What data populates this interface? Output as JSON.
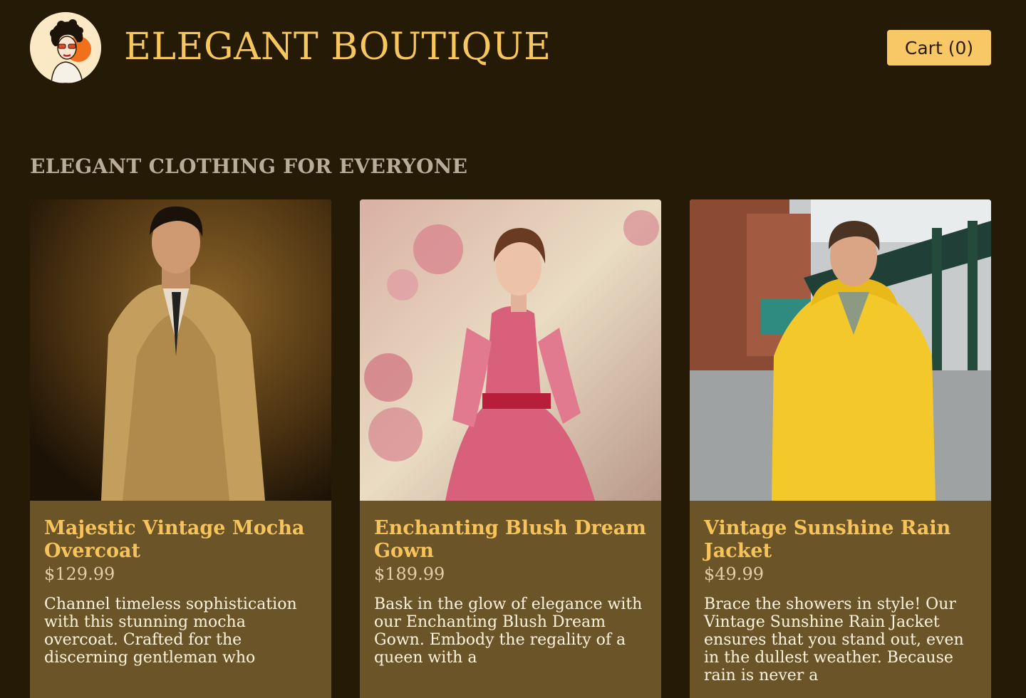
{
  "header": {
    "brand": "ELEGANT BOUTIQUE",
    "cart_label": "Cart (0)"
  },
  "main": {
    "section_title": "ELEGANT CLOTHING FOR EVERYONE",
    "products": [
      {
        "name": "Majestic Vintage Mocha Overcoat",
        "price": "$129.99",
        "description": "Channel timeless sophistication with this stunning mocha overcoat. Crafted for the discerning gentleman who"
      },
      {
        "name": "Enchanting Blush Dream Gown",
        "price": "$189.99",
        "description": "Bask in the glow of elegance with our Enchanting Blush Dream Gown. Embody the regality of a queen with a"
      },
      {
        "name": "Vintage Sunshine Rain Jacket",
        "price": "$49.99",
        "description": "Brace the showers in style! Our Vintage Sunshine Rain Jacket ensures that you stand out, even in the dullest weather. Because rain is never a"
      }
    ]
  },
  "colors": {
    "background": "#251a06",
    "accent": "#f7c75e",
    "card": "#6b5528",
    "button": "#f8c867"
  }
}
